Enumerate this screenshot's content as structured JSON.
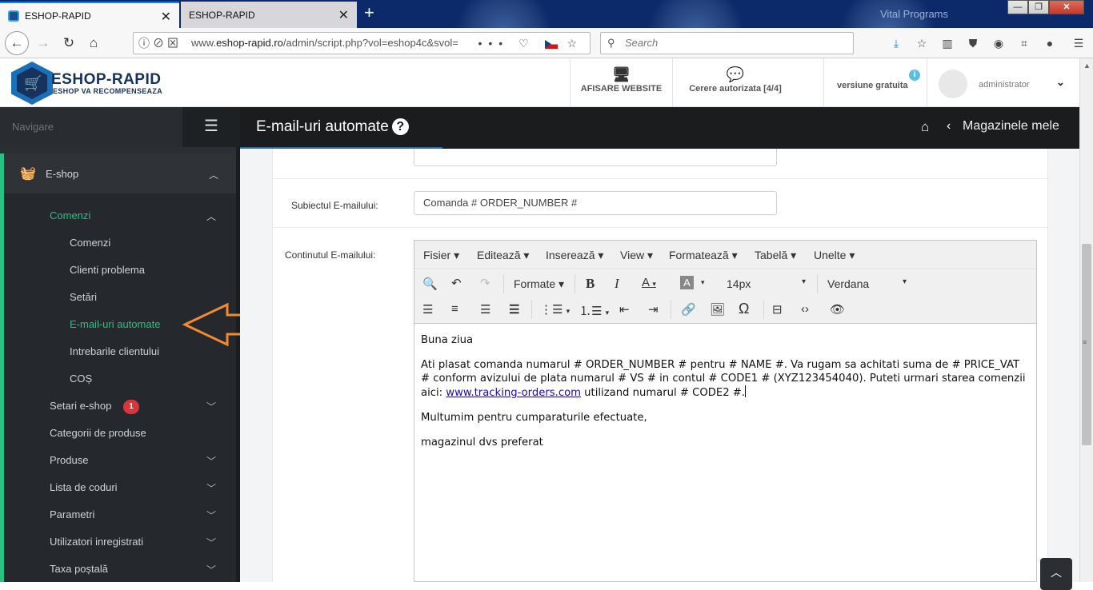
{
  "browser": {
    "tabs": [
      {
        "label": "ESHOP-RAPID",
        "active": true
      },
      {
        "label": "ESHOP-RAPID",
        "active": false
      }
    ],
    "window_title_art": "Vital Programs",
    "url_prefix": "www.",
    "url_main": "eshop-rapid.ro",
    "url_suffix": "/admin/script.php?vol=eshop4c&svol=",
    "search_placeholder": "Search"
  },
  "app": {
    "brand": "ESHOP-RAPID",
    "tagline": "ESHOP VA RECOMPENSEAZA",
    "header": {
      "website_label": "AFISARE WEBSITE",
      "requests_label": "Cerere autorizata [4/4]",
      "version_label": "versiune gratuita",
      "user_label": "administrator"
    },
    "page_title": "E-mail-uri automate",
    "shops_label": "Magazinele mele"
  },
  "sidebar": {
    "nav_label": "Navigare",
    "section": "E-shop",
    "group": "Comenzi",
    "sub_items": [
      "Comenzi",
      "Clienti problema",
      "Setări",
      "E-mail-uri automate",
      "Intrebarile clientului",
      "COȘ"
    ],
    "active_item": "E-mail-uri automate",
    "items": [
      "Setari e-shop",
      "Categorii de produse",
      "Produse",
      "Lista de coduri",
      "Parametri",
      "Utilizatori inregistrati",
      "Taxa poștală"
    ],
    "setari_badge": "1"
  },
  "form": {
    "subject_label": "Subiectul E-mailului:",
    "subject_value": "Comanda # ORDER_NUMBER #",
    "content_label": "Continutul E-mailului:"
  },
  "editor": {
    "menu": [
      "Fisier",
      "Editează",
      "Inserează",
      "View",
      "Formatează",
      "Tabelă",
      "Unelte"
    ],
    "formats_label": "Formate",
    "font_size": "14px",
    "font_family": "Verdana",
    "body": {
      "greeting": "Buna ziua",
      "para_text": "Ati plasat comanda numarul # ORDER_NUMBER # pentru # NAME #. Va rugam sa achitati suma de # PRICE_VAT # conform avizului de plata numarul # VS # in contul # CODE1 # (XYZ123454040). Puteti urmari starea comenzii aici: ",
      "link": "www.tracking-orders.com",
      "para_end": " utilizand numarul # CODE2 #.",
      "thanks": "Multumim pentru cumparaturile efectuate,",
      "signature": "magazinul dvs preferat"
    }
  },
  "colors": {
    "accent_green": "#27c281",
    "sidebar_bg": "#2b2f33",
    "title_bg": "#1b1c1e",
    "arrow_orange": "#f28a30",
    "badge_red": "#d9353b"
  }
}
